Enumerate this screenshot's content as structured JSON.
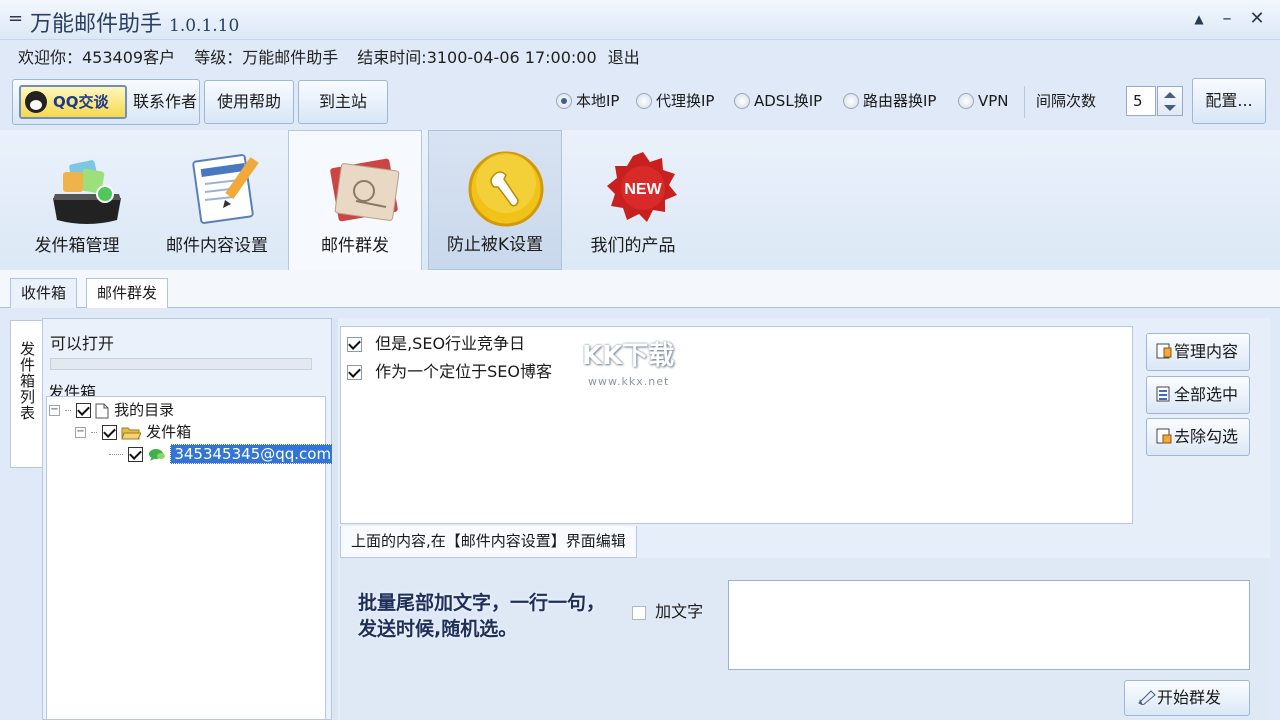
{
  "window": {
    "title": "万能邮件助手",
    "version": "1.0.1.10",
    "sysmenu_glyph": "=",
    "minimize_glyph": "▲",
    "restore_glyph": "–",
    "close_glyph": "✕"
  },
  "info": {
    "welcome": "欢迎你：453409客户",
    "level": "等级：万能邮件助手",
    "end_time": "结束时间:3100-04-06 17:00:00",
    "exit": "退出"
  },
  "toolbar": {
    "qq_button": "QQ交谈",
    "contact_author": "联系作者",
    "help": "使用帮助",
    "home_site": "到主站",
    "ip_options": [
      {
        "label": "本地IP",
        "selected": true
      },
      {
        "label": "代理换IP",
        "selected": false
      },
      {
        "label": "ADSL换IP",
        "selected": false
      },
      {
        "label": "路由器换IP",
        "selected": false
      },
      {
        "label": "VPN",
        "selected": false
      }
    ],
    "interval_label": "间隔次数",
    "interval_value": "5",
    "config_button": "配置..."
  },
  "nav": {
    "tabs": [
      {
        "label": "发件箱管理"
      },
      {
        "label": "邮件内容设置"
      },
      {
        "label": "邮件群发"
      },
      {
        "label": "防止被K设置"
      },
      {
        "label": "我们的产品"
      }
    ],
    "new_badge": "NEW"
  },
  "subtabs": [
    "收件箱",
    "邮件群发"
  ],
  "left": {
    "vertical_tab": "发件箱列表",
    "can_open": "可以打开",
    "outbox_label": "发件箱",
    "tree": {
      "root": "我的目录",
      "folder": "发件箱",
      "account": "345345345@qq.com"
    }
  },
  "content_list": {
    "items": [
      {
        "text": "但是,SEO行业竞争日",
        "checked": true
      },
      {
        "text": "作为一个定位于SEO博客",
        "checked": true
      }
    ]
  },
  "side_buttons": {
    "manage": "管理内容",
    "select_all": "全部选中",
    "uncheck": "去除勾选"
  },
  "edit_note": "上面的内容,在【邮件内容设置】界面编辑",
  "tail": {
    "description": "批量尾部加文字，一行一句，发送时候,随机选。",
    "add_text_label": "加文字",
    "add_text_checked": false,
    "input_value": ""
  },
  "start_button": "开始群发",
  "watermark": {
    "brand": "KK下载",
    "url": "www.kkx.net"
  },
  "colors": {
    "accent": "#3375d6",
    "window_bg": "#dfe9f7",
    "qq_yellow": "#f5d94a"
  }
}
